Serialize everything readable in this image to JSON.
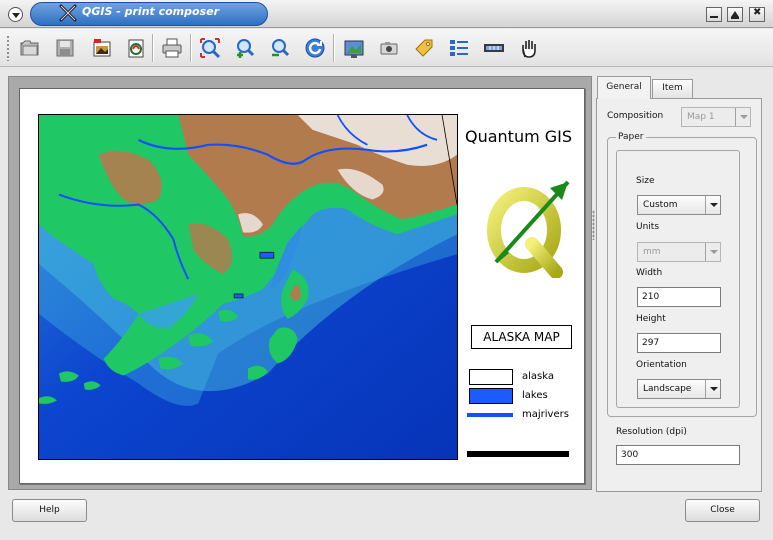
{
  "window": {
    "title": "QGIS - print composer"
  },
  "toolbar": {
    "buttons": [
      {
        "name": "open-template",
        "icon": "folder-open-icon"
      },
      {
        "name": "save-template",
        "icon": "floppy-disk-icon"
      },
      {
        "name": "export-image",
        "icon": "image-export-icon"
      },
      {
        "name": "export-svg",
        "icon": "svg-export-icon"
      },
      {
        "name": "print",
        "icon": "printer-icon"
      },
      {
        "name": "zoom-full",
        "icon": "zoom-full-icon"
      },
      {
        "name": "zoom-in",
        "icon": "zoom-in-icon"
      },
      {
        "name": "zoom-out",
        "icon": "zoom-out-icon"
      },
      {
        "name": "refresh",
        "icon": "refresh-icon"
      },
      {
        "name": "add-map",
        "icon": "add-map-icon"
      },
      {
        "name": "add-image",
        "icon": "camera-icon"
      },
      {
        "name": "add-label",
        "icon": "label-tag-icon"
      },
      {
        "name": "add-legend",
        "icon": "legend-icon"
      },
      {
        "name": "add-scalebar",
        "icon": "scalebar-icon"
      },
      {
        "name": "select-move",
        "icon": "hand-icon"
      }
    ]
  },
  "composition": {
    "map_title": "Quantum GIS",
    "map_label": "ALASKA MAP",
    "legend": [
      {
        "label": "alaska",
        "kind": "fill",
        "color": "#ffffff"
      },
      {
        "label": "lakes",
        "kind": "fill",
        "color": "#1a5cff"
      },
      {
        "label": "majrivers",
        "kind": "line",
        "color": "#1050ff"
      }
    ]
  },
  "panel": {
    "tabs": [
      "General",
      "Item"
    ],
    "active_tab": "General",
    "composition_label": "Composition",
    "composition_value": "Map 1",
    "paper_group": "Paper",
    "size_label": "Size",
    "size_value": "Custom",
    "units_label": "Units",
    "units_value": "mm",
    "width_label": "Width",
    "width_value": "210",
    "height_label": "Height",
    "height_value": "297",
    "orientation_label": "Orientation",
    "orientation_value": "Landscape",
    "resolution_label": "Resolution (dpi)",
    "resolution_value": "300"
  },
  "buttons": {
    "help": "Help",
    "close": "Close"
  },
  "colors": {
    "title_bar": "#2f6fc4",
    "ocean": "#0a3fcc",
    "land_green": "#1fc765",
    "land_brown": "#b27b4e"
  }
}
